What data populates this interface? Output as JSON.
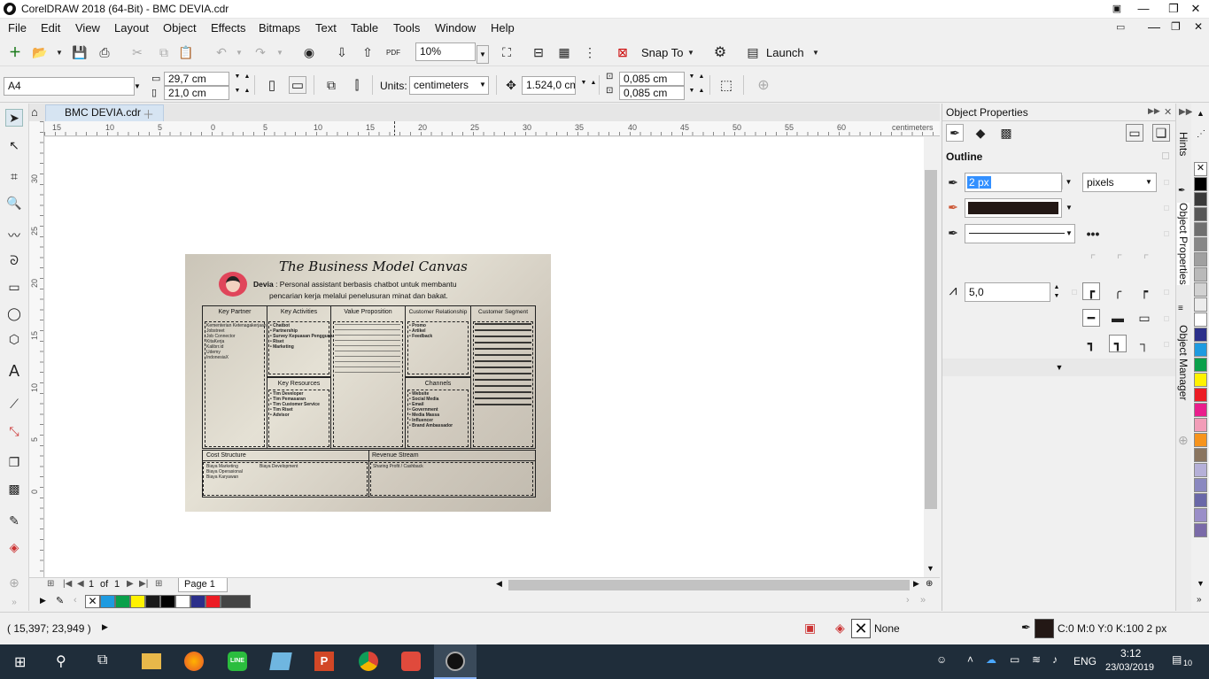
{
  "window": {
    "title": "CorelDRAW 2018 (64-Bit) - BMC DEVIA.cdr"
  },
  "menu": [
    "File",
    "Edit",
    "View",
    "Layout",
    "Object",
    "Effects",
    "Bitmaps",
    "Text",
    "Table",
    "Tools",
    "Window",
    "Help"
  ],
  "toolbar": {
    "zoom": "10%",
    "snap_label": "Snap To",
    "launch_label": "Launch"
  },
  "propbar": {
    "page_size": "A4",
    "width": "29,7 cm",
    "height": "21,0 cm",
    "units_label": "Units:",
    "units_value": "centimeters",
    "nudge": "1.524,0 cm",
    "dup_x": "0,085 cm",
    "dup_y": "0,085 cm"
  },
  "doc_tab": "BMC DEVIA.cdr",
  "ruler": {
    "h_ticks": [
      "15",
      "10",
      "5",
      "0",
      "5",
      "10",
      "15",
      "20",
      "25",
      "30",
      "35",
      "40",
      "45",
      "50",
      "55",
      "60"
    ],
    "units": "centimeters",
    "v_ticks": [
      "30",
      "25",
      "20",
      "15",
      "10",
      "5",
      "0"
    ]
  },
  "page_nav": {
    "current": "1",
    "of": "of",
    "total": "1",
    "page_tab": "Page 1"
  },
  "docker": {
    "title": "Object Properties",
    "section": "Outline",
    "width": "2 px",
    "width_unit": "pixels",
    "miter": "5,0"
  },
  "docker_tabs": [
    "Hints",
    "Object Properties",
    "Object Manager"
  ],
  "status": {
    "coords": "( 15,397; 23,949 )",
    "fill_label": "None",
    "outline_label": "C:0 M:0 Y:0 K:100  2 px"
  },
  "taskbar": {
    "lang": "ENG",
    "time": "3:12",
    "date": "23/03/2019",
    "notif": "10"
  },
  "colors": {
    "palette": [
      "#000000",
      "#3a3a3a",
      "#575757",
      "#6f6f6f",
      "#878787",
      "#a0a0a0",
      "#b9b9b9",
      "#d2d2d2",
      "#ececec",
      "#ffffff",
      "#2b2f8a",
      "#1e9be0",
      "#0aa04a",
      "#fff200",
      "#ec1c24",
      "#e91e8c",
      "#f29db8",
      "#f7941d",
      "#8a7560",
      "#b5b0d8",
      "#8a88c0",
      "#6a68a8",
      "#9a8ec8",
      "#7a6aa8"
    ],
    "doc_palette": [
      "#1e9be0",
      "#0aa04a",
      "#fff200",
      "#1a1a1a",
      "#000000",
      "#ffffff",
      "#2b2f8a",
      "#ec1c24",
      "#444444"
    ]
  },
  "bmc": {
    "title": "The Business Model Canvas",
    "brand": "Devia",
    "subtitle_line1": ": Personal assistant berbasis chatbot untuk membantu",
    "subtitle_line2": "pencarian kerja melalui penelusuran minat dan bakat.",
    "headers": {
      "kp": "Key Partner",
      "ka": "Key Activities",
      "vp": "Value Proposition",
      "cr": "Customer Relationship",
      "cs": "Customer Segment",
      "kr": "Key Resources",
      "ch": "Channels",
      "cost": "Cost Structure",
      "rev": "Revenue Stream"
    },
    "kp_items": "Kementerian Ketenagakerjaan\nJobstreet\nJob Connector\nKitaKerja\nKalibrr.id\nUdemy\nIndonesiaX",
    "ka_items": "• Chatbot\n• Partnership\n• Survey Kepuasan Pengguna\n• Riset\n• Marketing",
    "kr_items": "• Tim Developer\n• Tim Pemasaran\n• Tim Customer Service\n• Tim Riset\n• Advisor",
    "cr_items": "• Promo\n• Artikel\n• Feedback",
    "ch_items": "• Website\n• Social Media\n• Email\n• Government\n• Media Massa\n• Influencer\n• Brand Ambassador",
    "cost_items": "Biaya Marketing\nBiaya Operasional\nBiaya Karyawan",
    "cost_items2": "Biaya Development",
    "rev_items": "Sharing Profit / Cashback"
  }
}
